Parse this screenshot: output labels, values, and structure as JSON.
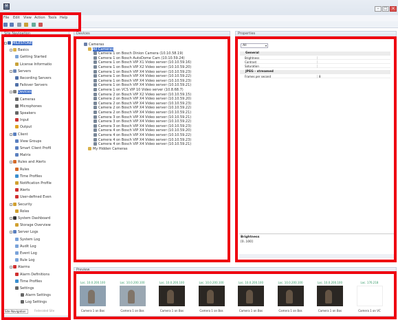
{
  "window": {
    "icon_label": "M",
    "min": "–",
    "max": "□",
    "close": "×"
  },
  "menu": [
    "File",
    "Edit",
    "View",
    "Action",
    "Tools",
    "Help"
  ],
  "panes": {
    "site_navigation": "Site Navigation",
    "devices": "Devices",
    "properties": "Properties",
    "preview": "Preview"
  },
  "nav_tree": [
    {
      "label": "MILESTONE",
      "level": 0,
      "icon": "server-icon",
      "color": "#3a5fa8",
      "selected": true
    },
    {
      "label": "Basics",
      "level": 1,
      "icon": "folder-icon",
      "color": "#d9b24a"
    },
    {
      "label": "Getting Started",
      "level": 2,
      "icon": "page-icon",
      "color": "#7aa3d9"
    },
    {
      "label": "License Informatio",
      "level": 2,
      "icon": "license-icon",
      "color": "#c8a23a"
    },
    {
      "label": "Servers",
      "level": 1,
      "icon": "server-icon",
      "color": "#6b86b5"
    },
    {
      "label": "Recording Servers",
      "level": 2,
      "icon": "server-icon",
      "color": "#5070a8"
    },
    {
      "label": "Failover Servers",
      "level": 2,
      "icon": "server-icon",
      "color": "#5070a8"
    },
    {
      "label": "Devices",
      "level": 1,
      "icon": "camera-icon",
      "color": "#7a7a7a",
      "selected": true
    },
    {
      "label": "Cameras",
      "level": 2,
      "icon": "camera-icon",
      "color": "#666"
    },
    {
      "label": "Microphones",
      "level": 2,
      "icon": "microphone-icon",
      "color": "#666"
    },
    {
      "label": "Speakers",
      "level": 2,
      "icon": "speaker-icon",
      "color": "#666"
    },
    {
      "label": "Input",
      "level": 2,
      "icon": "input-icon",
      "color": "#c33"
    },
    {
      "label": "Output",
      "level": 2,
      "icon": "output-icon",
      "color": "#e0a020"
    },
    {
      "label": "Client",
      "level": 1,
      "icon": "client-icon",
      "color": "#5a7fbf"
    },
    {
      "label": "View Groups",
      "level": 2,
      "icon": "view-icon",
      "color": "#5a7fbf"
    },
    {
      "label": "Smart Client Profil",
      "level": 2,
      "icon": "profile-icon",
      "color": "#5a7fbf"
    },
    {
      "label": "Matrix",
      "level": 2,
      "icon": "matrix-icon",
      "color": "#5a7fbf"
    },
    {
      "label": "Rules and Alerts",
      "level": 1,
      "icon": "rules-icon",
      "color": "#d46a2a"
    },
    {
      "label": "Rules",
      "level": 2,
      "icon": "rules-icon",
      "color": "#d46a2a"
    },
    {
      "label": "Time Profiles",
      "level": 2,
      "icon": "clock-icon",
      "color": "#3a8fd0"
    },
    {
      "label": "Notification Profile",
      "level": 2,
      "icon": "mail-icon",
      "color": "#d0a030"
    },
    {
      "label": "Alerts",
      "level": 2,
      "icon": "alert-icon",
      "color": "#d03030"
    },
    {
      "label": "User-defined Even",
      "level": 2,
      "icon": "event-icon",
      "color": "#d03030"
    },
    {
      "label": "Security",
      "level": 1,
      "icon": "lock-icon",
      "color": "#d0a030"
    },
    {
      "label": "Roles",
      "level": 2,
      "icon": "users-icon",
      "color": "#d0a030"
    },
    {
      "label": "System Dashboard",
      "level": 1,
      "icon": "dashboard-icon",
      "color": "#333"
    },
    {
      "label": "Storage Overview",
      "level": 2,
      "icon": "storage-icon",
      "color": "#d0a030"
    },
    {
      "label": "Server Logs",
      "level": 1,
      "icon": "log-icon",
      "color": "#5a7fbf"
    },
    {
      "label": "System Log",
      "level": 2,
      "icon": "page-icon",
      "color": "#7aa3d9"
    },
    {
      "label": "Audit Log",
      "level": 2,
      "icon": "page-icon",
      "color": "#7aa3d9"
    },
    {
      "label": "Event Log",
      "level": 2,
      "icon": "page-icon",
      "color": "#7aa3d9"
    },
    {
      "label": "Rule Log",
      "level": 2,
      "icon": "page-icon",
      "color": "#7aa3d9"
    },
    {
      "label": "Alarms",
      "level": 1,
      "icon": "alarm-icon",
      "color": "#d03030"
    },
    {
      "label": "Alarm Definitions",
      "level": 2,
      "icon": "alarm-icon",
      "color": "#d03030"
    },
    {
      "label": "Time Profiles",
      "level": 2,
      "icon": "clock-icon",
      "color": "#3a8fd0"
    },
    {
      "label": "Settings",
      "level": 2,
      "icon": "gear-icon",
      "color": "#666"
    },
    {
      "label": "Alarm Settings",
      "level": 3,
      "icon": "gear-icon",
      "color": "#666"
    },
    {
      "label": "Log Settings",
      "level": 3,
      "icon": "gear-icon",
      "color": "#666"
    }
  ],
  "nav_tabs": [
    "Site Navigation",
    "Federated Site"
  ],
  "device_tree": {
    "root": "Cameras",
    "group": "All Cameras",
    "cameras": [
      "Camera 1 on Bosch Dinion Camera (10.10.58.19)",
      "Camera 1 on Bosch AutoDome Cam (10.10.59.24)",
      "Camera 1 on Bosch VIP X1 Video server (10.10.59.16)",
      "Camera 1 on Bosch VIP X2 Video server (10.10.59.20)",
      "Camera 1 on Bosch VIP X4 Video server (10.10.59.23)",
      "Camera 1 on Bosch VIP X4 Video server (10.10.59.22)",
      "Camera 1 on Bosch VIP X4 Video server (10.10.59.23)",
      "Camera 1 on Bosch VIP X4 Video server (10.10.59.21)",
      "Camera 1 on VCS VIP 10 Video server (10.8.68.7)",
      "Camera 2 on Bosch VIP X2 Video server (10.10.59.15)",
      "Camera 2 on Bosch VIP X4 Video server (10.10.59.20)",
      "Camera 2 on Bosch VIP X4 Video server (10.10.59.23)",
      "Camera 2 on Bosch VIP X4 Video server (10.10.59.22)",
      "Camera 2 on Bosch VIP X4 Video server (10.10.59.21)",
      "Camera 3 on Bosch VIP X4 Video server (10.10.59.21)",
      "Camera 3 on Bosch VIP X4 Video server (10.10.59.22)",
      "Camera 3 on Bosch VIP X4 Video server (10.10.59.23)",
      "Camera 4 on Bosch VIP X4 Video server (10.10.59.20)",
      "Camera 4 on Bosch VIP X4 Video server (10.10.59.22)",
      "Camera 4 on Bosch VIP X4 Video server (10.10.59.23)",
      "Camera 4 on Bosch VIP X4 Video server (10.10.59.21)"
    ],
    "other_group": "My Hidden Cameras"
  },
  "properties": {
    "selector_value": "All",
    "cat_general": "General",
    "general_rows": [
      {
        "name": "Brightness",
        "value": ""
      },
      {
        "name": "Contrast",
        "value": ""
      },
      {
        "name": "Saturation",
        "value": ""
      }
    ],
    "cat_jpeg": "JPEG - streamed",
    "jpeg_rows": [
      {
        "name": "Frames per second",
        "value": "8"
      }
    ],
    "desc_title": "Brightness",
    "desc_text": "[0..100]"
  },
  "preview": {
    "thumbs": [
      {
        "name": "Loc. 10.0.200.100",
        "caption": "Camera 1 on Bos",
        "tone": "#8ea0b0"
      },
      {
        "name": "Loc. 10.0.200.100",
        "caption": "Camera 1 on Bos",
        "tone": "#9aa7b2"
      },
      {
        "name": "Loc. 10.0.200.100",
        "caption": "Camera 1 on Bos",
        "tone": "#2b2723"
      },
      {
        "name": "Loc. 10.0.200.100",
        "caption": "Camera 1 on Bos",
        "tone": "#2b2723"
      },
      {
        "name": "Loc. 10.0.200.100",
        "caption": "Camera 1 on Bos",
        "tone": "#2b2723"
      },
      {
        "name": "Loc. 10.0.200.100",
        "caption": "Camera 1 on Bos",
        "tone": "#2b2723"
      },
      {
        "name": "Loc. 10.0.200.100",
        "caption": "Camera 1 on Bos",
        "tone": "#2b2723"
      },
      {
        "name": "Loc. 176.218",
        "caption": "Camera 1 on VC",
        "tone": "#ffffff"
      }
    ]
  },
  "highlight_color": "#ee0010"
}
